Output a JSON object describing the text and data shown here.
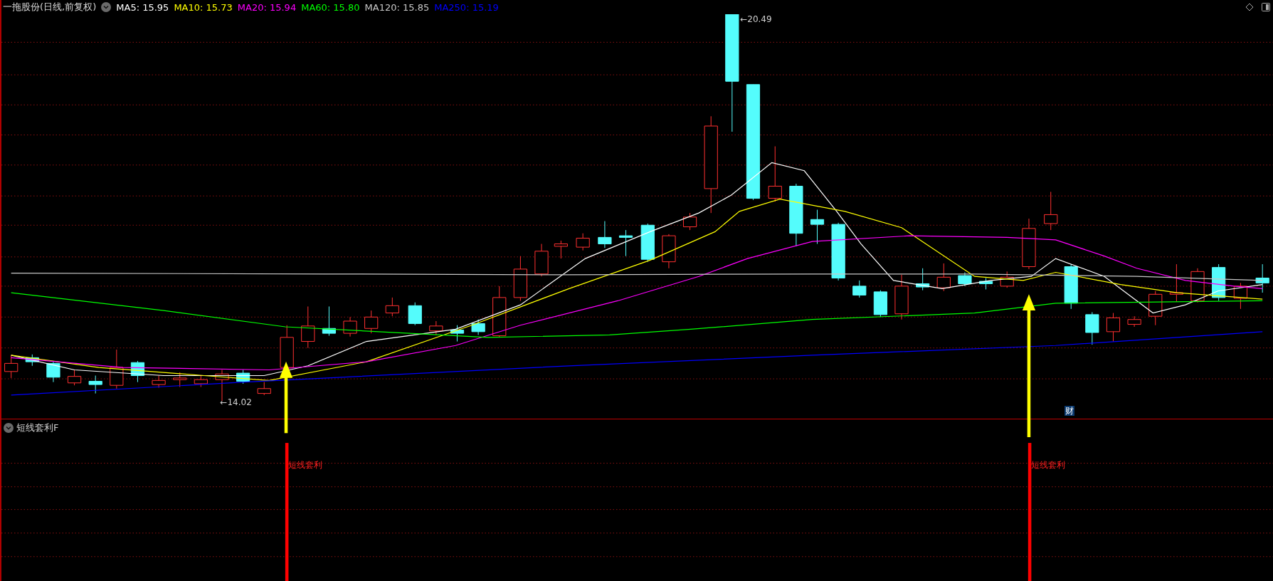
{
  "chart": {
    "title": "一拖股份(日线,前复权)",
    "indicators": [
      {
        "label": "MA5: 15.95",
        "color": "#ffffff"
      },
      {
        "label": "MA10: 15.73",
        "color": "#ffff00"
      },
      {
        "label": "MA20: 15.94",
        "color": "#ff00ff"
      },
      {
        "label": "MA60: 15.80",
        "color": "#00ff00"
      },
      {
        "label": "MA120: 15.85",
        "color": "#c8c8c8"
      },
      {
        "label": "MA250: 15.19",
        "color": "#0000ff"
      }
    ],
    "high_label": "←20.49",
    "low_label": "←14.02",
    "marker": "财"
  },
  "indicator_panel": {
    "title": "短线套利F",
    "signals": [
      {
        "label": "短线套利"
      },
      {
        "label": "短线套利"
      }
    ]
  }
}
